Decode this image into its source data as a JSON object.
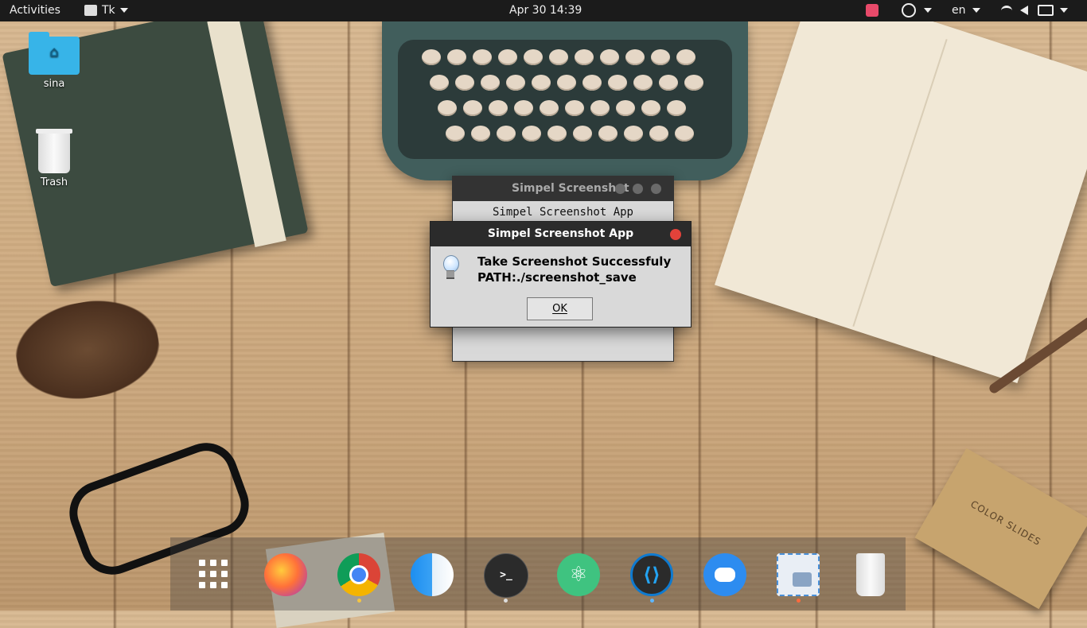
{
  "topbar": {
    "activities": "Activities",
    "app_menu": "Tk",
    "clock": "Apr 30  14:39",
    "language": "en"
  },
  "desktop": {
    "icons": [
      {
        "label": "sina",
        "icon": "folder-icon"
      },
      {
        "label": "Trash",
        "icon": "trash-icon"
      }
    ],
    "box_label": "COLOR SLIDES"
  },
  "back_window": {
    "title": "Simpel Screenshot",
    "content": "Simpel Screenshot App"
  },
  "dialog": {
    "title": "Simpel Screenshot App",
    "line1": "Take Screenshot Successfuly",
    "line2": "PATH:./screenshot_save",
    "ok": "OK"
  },
  "dock": {
    "apps": [
      "show-applications",
      "firefox",
      "chrome",
      "finder",
      "terminal",
      "atom",
      "vscode",
      "discord",
      "screenshot-app",
      "trash"
    ]
  },
  "colors": {
    "topbar": "#1b1b1b",
    "close": "#e3423a",
    "folder": "#37b4e8"
  }
}
